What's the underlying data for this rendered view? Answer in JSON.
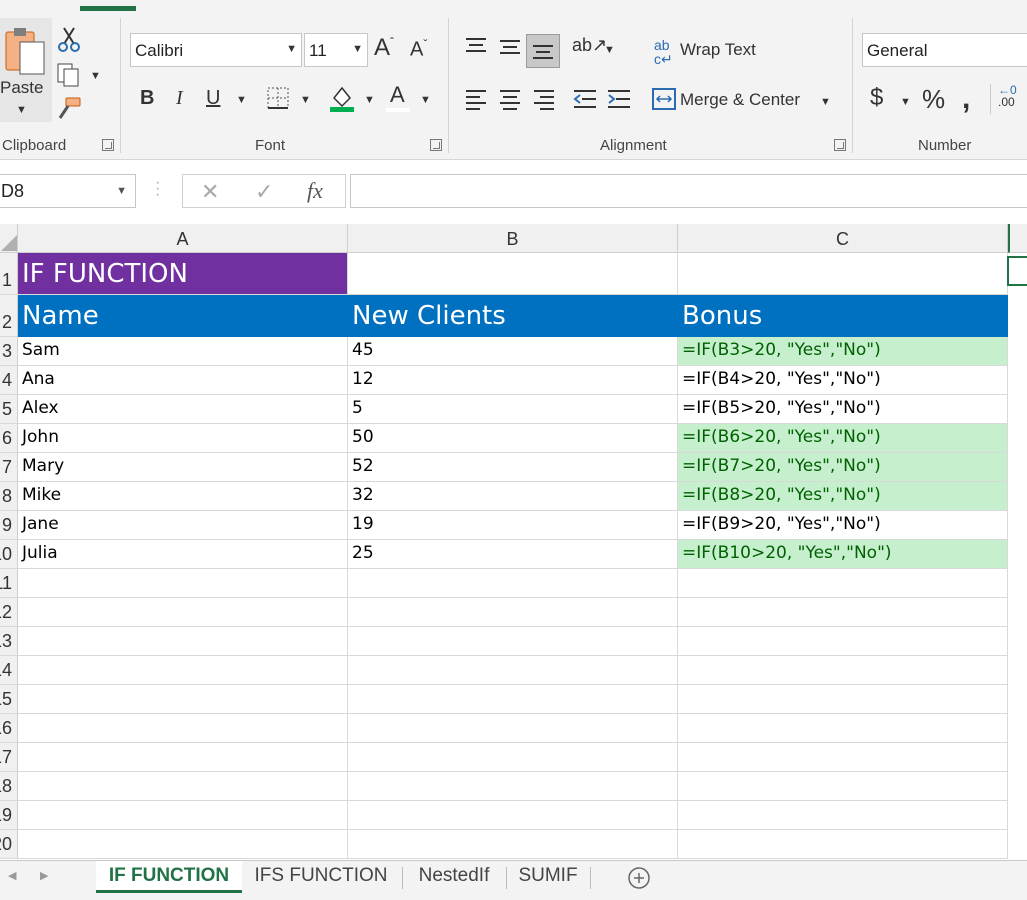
{
  "ribbon": {
    "clipboard": {
      "paste_label": "Paste",
      "group_label": "Clipboard"
    },
    "font": {
      "name": "Calibri",
      "size": "11",
      "group_label": "Font",
      "fill_color": "#00b050",
      "font_color": "#ff0000"
    },
    "alignment": {
      "wrap_text_label": "Wrap Text",
      "merge_center_label": "Merge & Center",
      "group_label": "Alignment"
    },
    "number": {
      "format": "General",
      "group_label": "Number"
    }
  },
  "formula_bar": {
    "name_box": "D8",
    "formula": ""
  },
  "grid": {
    "columns": [
      "A",
      "B",
      "C"
    ],
    "rows": [
      {
        "num": "1",
        "a": "IF FUNCTION",
        "b": "",
        "c": "",
        "hl": false
      },
      {
        "num": "2",
        "a": "Name",
        "b": "New Clients",
        "c": "Bonus",
        "hl": false
      },
      {
        "num": "3",
        "a": "Sam",
        "b": "45",
        "c": "=IF(B3>20, \"Yes\",\"No\")",
        "hl": true
      },
      {
        "num": "4",
        "a": "Ana",
        "b": "12",
        "c": "=IF(B4>20, \"Yes\",\"No\")",
        "hl": false
      },
      {
        "num": "5",
        "a": "Alex",
        "b": "5",
        "c": "=IF(B5>20, \"Yes\",\"No\")",
        "hl": false
      },
      {
        "num": "6",
        "a": "John",
        "b": "50",
        "c": "=IF(B6>20, \"Yes\",\"No\")",
        "hl": true
      },
      {
        "num": "7",
        "a": "Mary",
        "b": "52",
        "c": "=IF(B7>20, \"Yes\",\"No\")",
        "hl": true
      },
      {
        "num": "8",
        "a": "Mike",
        "b": "32",
        "c": "=IF(B8>20, \"Yes\",\"No\")",
        "hl": true
      },
      {
        "num": "9",
        "a": "Jane",
        "b": "19",
        "c": "=IF(B9>20, \"Yes\",\"No\")",
        "hl": false
      },
      {
        "num": "10",
        "a": "Julia",
        "b": "25",
        "c": "=IF(B10>20, \"Yes\",\"No\")",
        "hl": true
      },
      {
        "num": "11",
        "a": "",
        "b": "",
        "c": "",
        "hl": false
      },
      {
        "num": "12",
        "a": "",
        "b": "",
        "c": "",
        "hl": false
      },
      {
        "num": "13",
        "a": "",
        "b": "",
        "c": "",
        "hl": false
      },
      {
        "num": "14",
        "a": "",
        "b": "",
        "c": "",
        "hl": false
      },
      {
        "num": "15",
        "a": "",
        "b": "",
        "c": "",
        "hl": false
      },
      {
        "num": "16",
        "a": "",
        "b": "",
        "c": "",
        "hl": false
      },
      {
        "num": "17",
        "a": "",
        "b": "",
        "c": "",
        "hl": false
      },
      {
        "num": "18",
        "a": "",
        "b": "",
        "c": "",
        "hl": false
      },
      {
        "num": "19",
        "a": "",
        "b": "",
        "c": "",
        "hl": false
      },
      {
        "num": "20",
        "a": "",
        "b": "",
        "c": "",
        "hl": false
      }
    ],
    "colors": {
      "title_fill": "#7030a0",
      "header_fill": "#0070c0",
      "highlight_fill": "#c6efce",
      "highlight_text": "#006100"
    }
  },
  "sheet_tabs": [
    {
      "label": "IF FUNCTION",
      "active": true
    },
    {
      "label": "IFS FUNCTION",
      "active": false
    },
    {
      "label": "NestedIf",
      "active": false
    },
    {
      "label": "SUMIF",
      "active": false
    }
  ]
}
